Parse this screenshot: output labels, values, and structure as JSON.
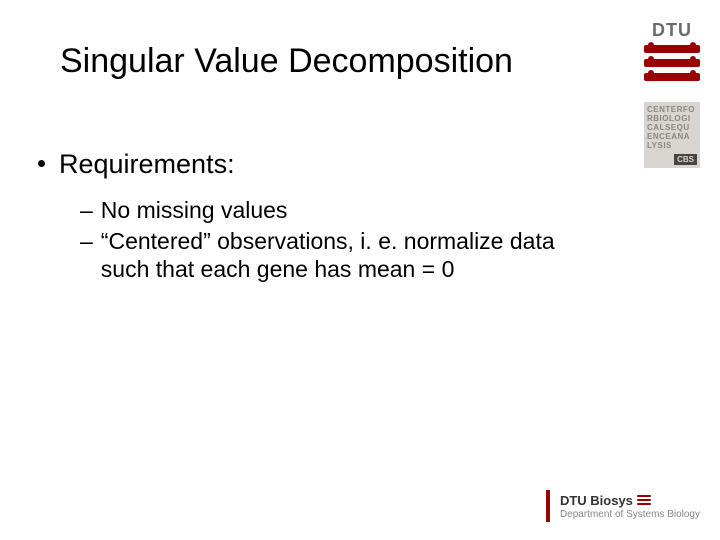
{
  "title": "Singular Value Decomposition",
  "bullets": {
    "l1": "Requirements:",
    "l2a": "No missing values",
    "l2b": "“Centered” observations, i. e. normalize data such that each gene has mean = 0"
  },
  "logos": {
    "dtu_letters": "DTU",
    "cbs_text": "CENTERFO\nRBIOLOGI\nCALSEQU\nENCEANA\nLYSIS",
    "cbs_badge": "CBS",
    "footer_line1": "DTU Biosys",
    "footer_line2": "Department of Systems Biology"
  }
}
